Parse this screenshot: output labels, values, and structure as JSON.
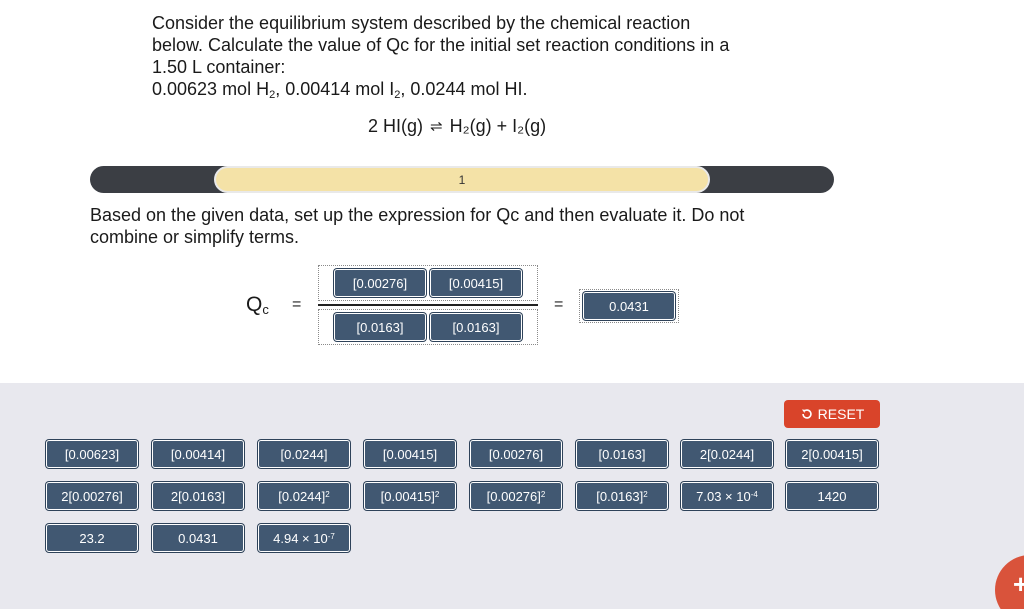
{
  "question": {
    "line1": "Consider the equilibrium system described by the chemical reaction",
    "line2": "below. Calculate the value of Qc for the initial set reaction conditions in a",
    "line3": "1.50 L container:",
    "amounts": {
      "h2_amount": "0.00623 mol H",
      "h2_sub": "2",
      "i2_amount": ", 0.00414 mol I",
      "i2_sub": "2",
      "hi_amount": ", 0.0244 mol HI."
    },
    "reaction_left": "2 HI(g)",
    "reaction_arrow": "⇌",
    "reaction_right": "H₂(g) + I₂(g)"
  },
  "progress": {
    "step_label": "1"
  },
  "instructions": "Based on the given data, set up the expression for Qc and then evaluate it. Do not combine or simplify terms.",
  "expression": {
    "qc_symbol": "Q",
    "qc_sub": "c",
    "equals_1": "=",
    "equals_2": "=",
    "numerator": [
      "[0.00276]",
      "[0.00415]"
    ],
    "denominator": [
      "[0.0163]",
      "[0.0163]"
    ],
    "result": "0.0431"
  },
  "tray": {
    "reset_label": "RESET",
    "row1": [
      "[0.00623]",
      "[0.00414]",
      "[0.0244]",
      "[0.00415]",
      "[0.00276]",
      "[0.0163]",
      "2[0.0244]",
      "2[0.00415]"
    ],
    "row2_plain": [
      "2[0.00276]",
      "2[0.0163]"
    ],
    "row2_squared_bases": [
      "[0.0244]",
      "[0.00415]",
      "[0.00276]",
      "[0.0163]"
    ],
    "squared_exp": "2",
    "row2_tail": {
      "sci_base": "7.03 × 10",
      "sci_exp": "-4",
      "value": "1420"
    },
    "row3_plain": [
      "23.2",
      "0.0431"
    ],
    "row3_sci": {
      "base": "4.94 × 10",
      "exp": "-7"
    }
  },
  "colors": {
    "tile_bg": "#415872",
    "progress_track": "#3b3e44",
    "progress_fill": "#f4e2a7",
    "reset_bg": "#d9442a",
    "tray_bg": "#e8e8ee"
  },
  "icons": {
    "reset": "undo-arrow-icon",
    "fab": "plus-icon"
  }
}
